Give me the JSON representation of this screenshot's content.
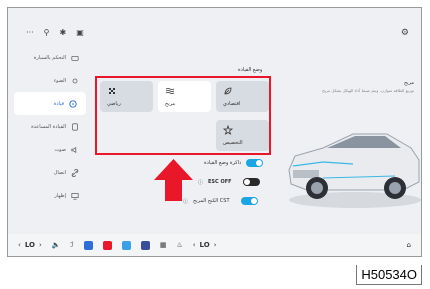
{
  "sidebar": {
    "items": [
      {
        "label": "التحكم بالسيارة",
        "icon": "car-control-icon"
      },
      {
        "label": "الضوء",
        "icon": "light-icon"
      },
      {
        "label": "قيادة",
        "icon": "steering-wheel-icon",
        "active": true
      },
      {
        "label": "القيادة المساعدة",
        "icon": "assist-driving-icon"
      },
      {
        "label": "صوت",
        "icon": "speaker-icon"
      },
      {
        "label": "اتصال",
        "icon": "link-icon"
      },
      {
        "label": "إظهار",
        "icon": "display-icon"
      }
    ]
  },
  "drive_mode": {
    "section_title": "وضع القيادة",
    "modes": [
      {
        "label": "رياضي",
        "icon": "sport-mode-icon"
      },
      {
        "label": "مريح",
        "icon": "comfort-mode-icon",
        "selected": true
      },
      {
        "label": "اقتصادي",
        "icon": "eco-mode-icon"
      },
      {
        "label": "التخصيص",
        "icon": "custom-mode-icon"
      }
    ],
    "selected_title": "مريح",
    "selected_description": "توزيع الطاقة متوازن، ويتم ضبط أداء الهيكل بشكل مريح"
  },
  "settings": {
    "memory_label": "ذاكرة وضع القيادة",
    "memory_on": true,
    "esc_label": "ESC OFF",
    "esc_on": false,
    "cst_label": "الكبح المريح CST",
    "cst_on": true
  },
  "bottom_bar": {
    "left_temp": "LO",
    "right_temp": "LO",
    "prev": "‹",
    "next": "›"
  },
  "code": "H50534O",
  "colors": {
    "accent": "#1aa6e4",
    "highlight_red": "#e8182a"
  }
}
